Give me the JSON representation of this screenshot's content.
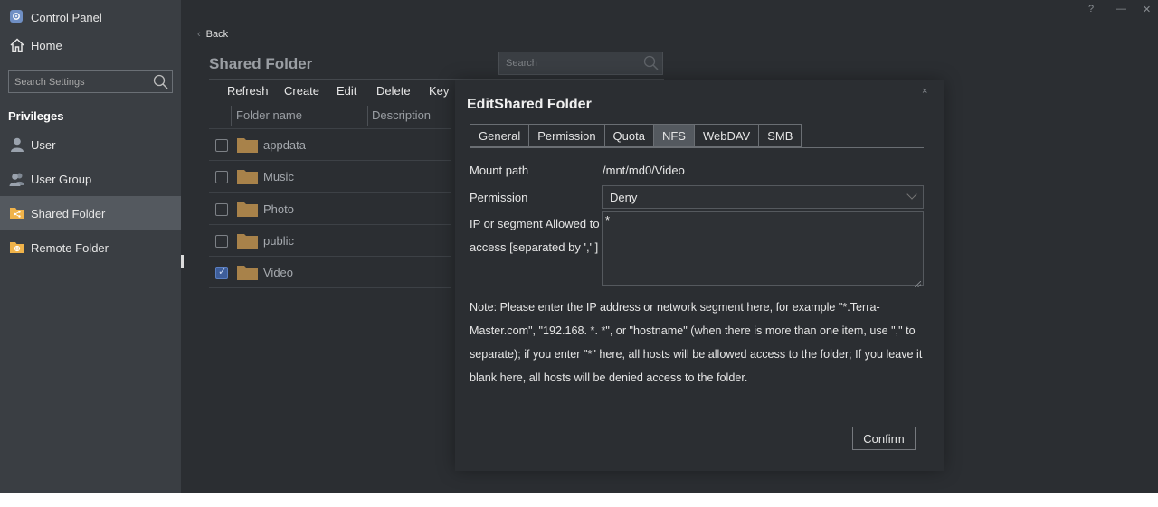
{
  "sidebar": {
    "app_title": "Control Panel",
    "home_label": "Home",
    "search_placeholder": "Search Settings",
    "section_title": "Privileges",
    "items": [
      {
        "label": "User",
        "icon": "user-icon"
      },
      {
        "label": "User Group",
        "icon": "user-group-icon"
      },
      {
        "label": "Shared Folder",
        "icon": "shared-folder-icon",
        "active": true
      },
      {
        "label": "Remote Folder",
        "icon": "remote-folder-icon"
      }
    ]
  },
  "window_controls": {
    "help": "?",
    "minimize": "—",
    "maximize": "□",
    "close": "✕"
  },
  "main": {
    "back_label": "Back",
    "title": "Shared Folder",
    "search_placeholder": "Search",
    "toolbar": {
      "refresh": "Refresh",
      "create": "Create",
      "edit": "Edit",
      "delete": "Delete",
      "key": "Key"
    },
    "table": {
      "columns": [
        "Folder name",
        "Description"
      ],
      "rows": [
        {
          "name": "appdata",
          "checked": false
        },
        {
          "name": "Music",
          "checked": false
        },
        {
          "name": "Photo",
          "checked": false
        },
        {
          "name": "public",
          "checked": false
        },
        {
          "name": "Video",
          "checked": true
        }
      ]
    }
  },
  "dialog": {
    "title": "EditShared Folder",
    "close": "×",
    "tabs": [
      "General",
      "Permission",
      "Quota",
      "NFS",
      "WebDAV",
      "SMB"
    ],
    "active_tab": "NFS",
    "mount_path_label": "Mount path",
    "mount_path_value": "/mnt/md0/Video",
    "permission_label": "Permission",
    "permission_value": "Deny",
    "ip_label_line1": "IP or segment Allowed to",
    "ip_label_line2": "access [separated by ',' ]",
    "ip_value": "*",
    "note": "Note: Please enter the IP address or network segment here, for example \"*.Terra-Master.com\", \"192.168. *. *\", or \"hostname\" (when there is more than one item, use \",\" to separate); if you enter \"*\" here, all hosts will be allowed access to the folder; If you leave it blank here, all hosts will be denied access to the folder.",
    "confirm_label": "Confirm"
  },
  "colors": {
    "sidebar_bg": "#3a3e43",
    "main_bg": "#2b2e32",
    "active_item": "#54595f",
    "folder": "#a8824a",
    "checkbox_checked": "#3e5e9a"
  }
}
